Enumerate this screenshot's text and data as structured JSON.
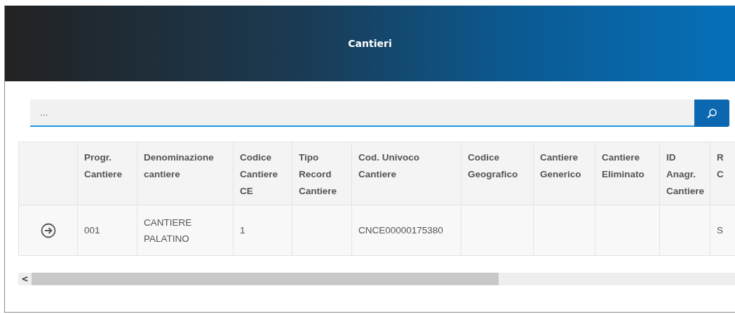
{
  "dialog": {
    "title": "Cantieri"
  },
  "search": {
    "placeholder": "..."
  },
  "table": {
    "columns": [
      {},
      {
        "label": "Progr. Cantiere"
      },
      {
        "label": "Denominazione cantiere"
      },
      {
        "label": "Codice Cantiere CE"
      },
      {
        "label": "Tipo Record Cantiere"
      },
      {
        "label": "Cod. Univoco Cantiere"
      },
      {
        "label": "Codice Geografico"
      },
      {
        "label": "Cantiere Generico"
      },
      {
        "label": "Cantiere Eliminato"
      },
      {
        "label": "ID Anagr. Cantiere"
      },
      {
        "label": "R C"
      }
    ],
    "rows": [
      {
        "cells": [
          null,
          "001",
          "CANTIERE PALATINO",
          "1",
          null,
          "CNCE00000175380",
          null,
          null,
          null,
          null,
          "S"
        ]
      }
    ]
  },
  "scrollbar": {
    "left_arrow": "<"
  }
}
